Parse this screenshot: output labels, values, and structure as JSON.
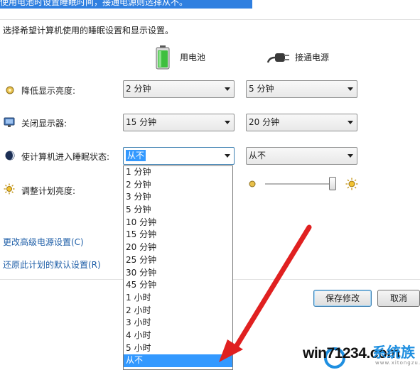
{
  "banner": {
    "text": "使用电池时设置睡眠时间，接通电源则选择从不。"
  },
  "instruction": "选择希望计算机使用的睡眠设置和显示设置。",
  "columns": {
    "battery": "用电池",
    "plugged": "接通电源"
  },
  "rows": {
    "dim": {
      "label": "降低显示亮度:",
      "battery": "2 分钟",
      "plugged": "5 分钟"
    },
    "off": {
      "label": "关闭显示器:",
      "battery": "15 分钟",
      "plugged": "20 分钟"
    },
    "sleep": {
      "label": "使计算机进入睡眠状态:",
      "battery": "从不",
      "plugged": "从不"
    },
    "brightness": {
      "label": "调整计划亮度:",
      "battery_level": 1.0
    }
  },
  "dropdown_options": [
    "1 分钟",
    "2 分钟",
    "3 分钟",
    "5 分钟",
    "10 分钟",
    "15 分钟",
    "20 分钟",
    "25 分钟",
    "30 分钟",
    "45 分钟",
    "1 小时",
    "2 小时",
    "3 小时",
    "4 小时",
    "5 小时",
    "从不"
  ],
  "dropdown_selected": "从不",
  "links": {
    "advanced": "更改高级电源设置(C)",
    "restore": "还原此计划的默认设置(R)"
  },
  "buttons": {
    "save": "保存修改",
    "cancel": "取消"
  },
  "watermark": {
    "text": "win71234.com",
    "cn": "系统族",
    "small": "www.xitongzu.com"
  },
  "colors": {
    "accent": "#3399ff",
    "link": "#1f5fa8",
    "arrow": "#e02020"
  }
}
